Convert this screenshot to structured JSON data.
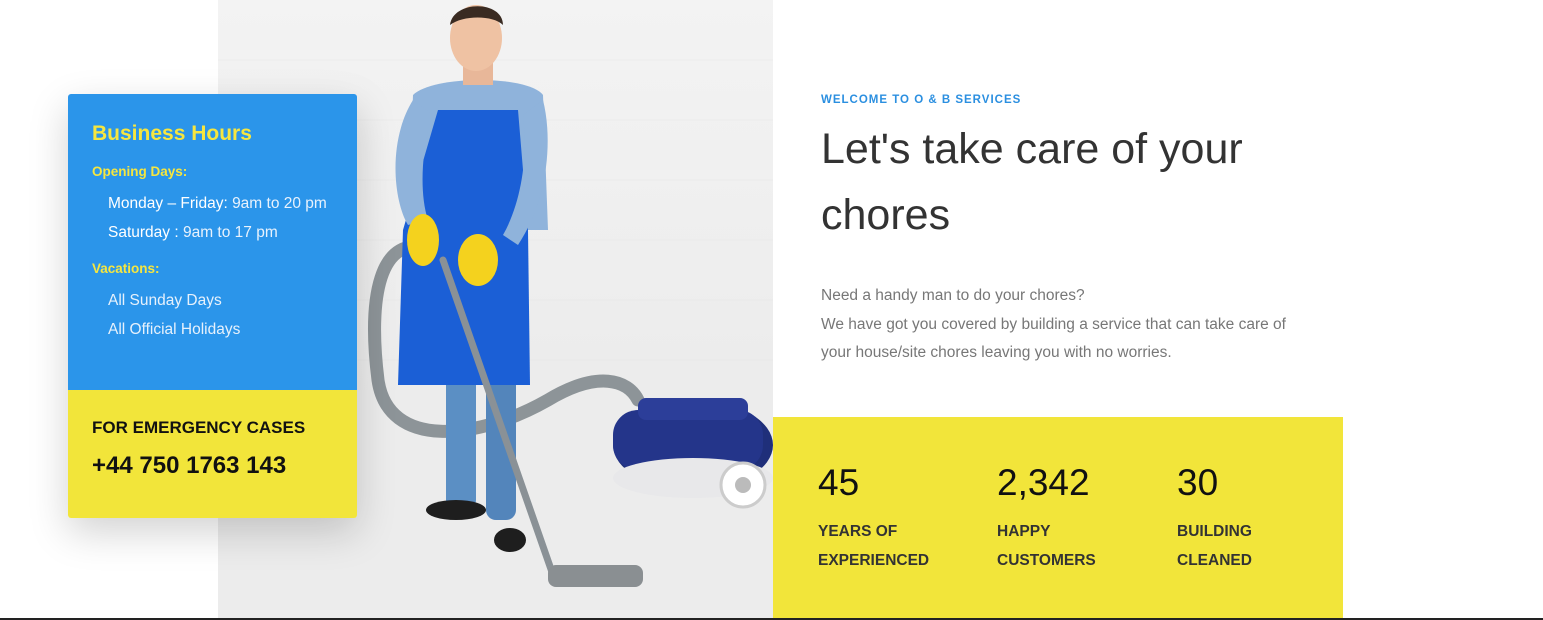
{
  "business_hours": {
    "title": "Business Hours",
    "opening_days_heading": "Opening Days:",
    "opening_days": [
      {
        "day": "Monday – Friday:",
        "time": "9am to 20 pm"
      },
      {
        "day": "Saturday :",
        "time": "9am to 17 pm"
      }
    ],
    "vacations_heading": "Vacations:",
    "vacations": [
      "All Sunday Days",
      "All Official Holidays"
    ],
    "emergency_label": "FOR EMERGENCY CASES",
    "emergency_phone": "+44 750 1763 143",
    "colors": {
      "blue": "#2b95ea",
      "yellow": "#f2e53a"
    }
  },
  "intro": {
    "eyebrow": "WELCOME TO O & B SERVICES",
    "headline_line1": "Let's take care of your",
    "headline_line2": "chores",
    "body_line1": "Need a handy man to do your chores?",
    "body_line2": "We have got you covered by building a service that can take care of",
    "body_line3": "your house/site chores leaving you with no worries."
  },
  "stats": [
    {
      "number": "45",
      "label_line1": "YEARS OF",
      "label_line2": "EXPERIENCED"
    },
    {
      "number": "2,342",
      "label_line1": "HAPPY",
      "label_line2": "CUSTOMERS"
    },
    {
      "number": "30",
      "label_line1": "BUILDING",
      "label_line2": "CLEANED"
    }
  ],
  "photo": {
    "subject": "cleaner-with-vacuum-photo"
  }
}
